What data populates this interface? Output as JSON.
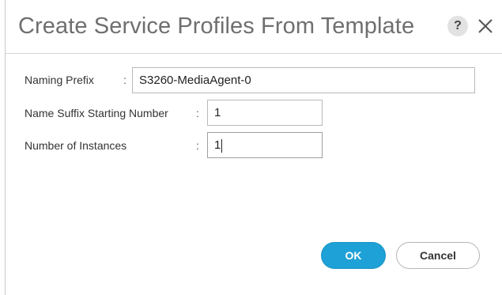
{
  "dialog": {
    "title": "Create Service Profiles From Template",
    "help_label": "?",
    "close_icon": "close-icon"
  },
  "form": {
    "naming_prefix": {
      "label": "Naming Prefix",
      "separator": ":",
      "value": "S3260-MediaAgent-0"
    },
    "suffix_start": {
      "label": "Name Suffix Starting Number",
      "separator": ":",
      "value": "1"
    },
    "instances": {
      "label": "Number of Instances",
      "separator": ":",
      "value": "1"
    }
  },
  "actions": {
    "ok_label": "OK",
    "cancel_label": "Cancel"
  },
  "colors": {
    "primary": "#1ea1d6",
    "title_text": "#6f6f6f"
  }
}
